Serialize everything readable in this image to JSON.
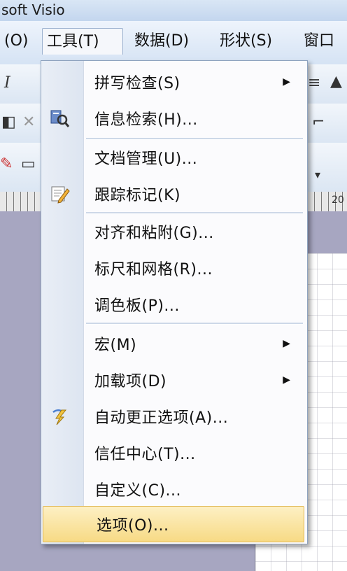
{
  "window": {
    "title": "soft Visio"
  },
  "menubar": {
    "items": [
      {
        "label": "(O)"
      },
      {
        "label": "工具(T)"
      },
      {
        "label": "数据(D)"
      },
      {
        "label": "形状(S)"
      },
      {
        "label": "窗口"
      }
    ]
  },
  "tools_menu": {
    "items": [
      {
        "label": "拼写检查(S)",
        "has_submenu": true
      },
      {
        "label": "信息检索(H)..."
      },
      {
        "label": "文档管理(U)..."
      },
      {
        "label": "跟踪标记(K)"
      },
      {
        "label": "对齐和粘附(G)..."
      },
      {
        "label": "标尺和网格(R)..."
      },
      {
        "label": "调色板(P)..."
      },
      {
        "label": "宏(M)",
        "has_submenu": true
      },
      {
        "label": "加载项(D)",
        "has_submenu": true
      },
      {
        "label": "自动更正选项(A)..."
      },
      {
        "label": "信任中心(T)..."
      },
      {
        "label": "自定义(C)..."
      },
      {
        "label": "选项(O)...",
        "highlighted": true
      }
    ],
    "submenu_arrow": "▶",
    "highlight_color": "#f7da85"
  },
  "toolbar": {
    "italic_label": "I",
    "ruler_number": "20"
  }
}
